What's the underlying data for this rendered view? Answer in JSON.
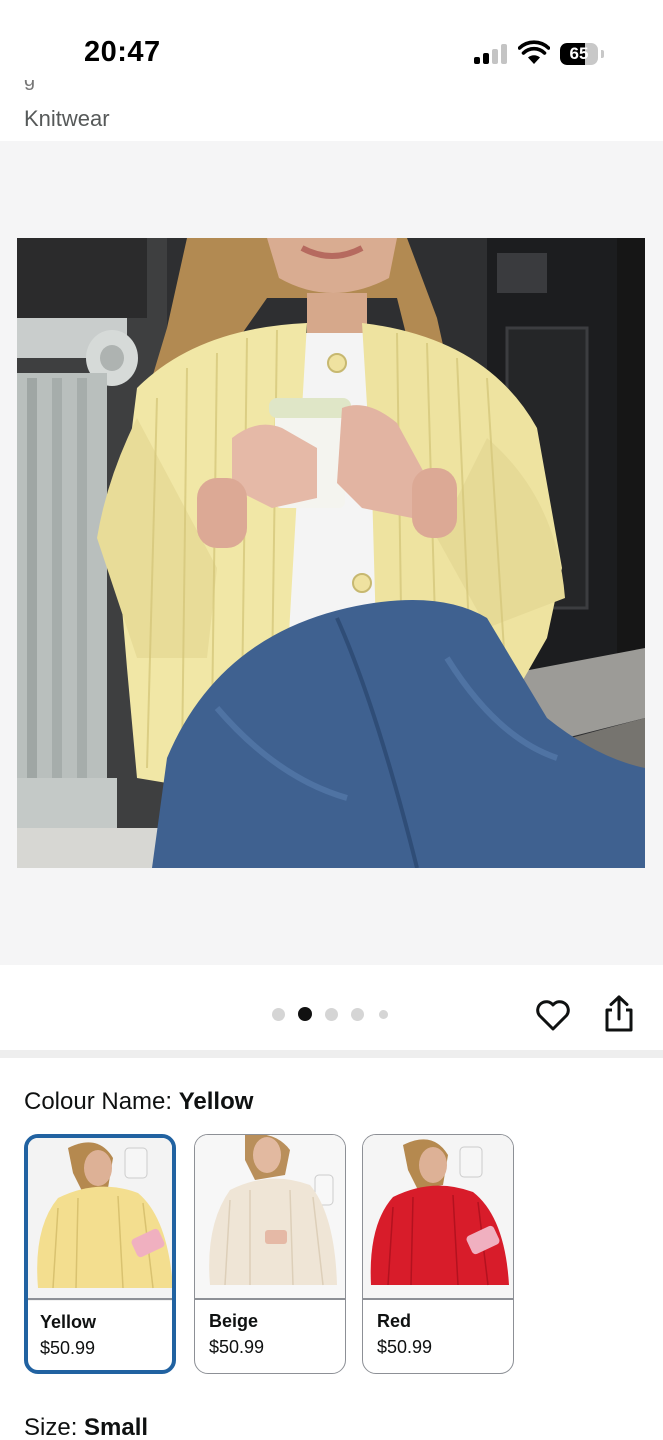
{
  "status_bar": {
    "time": "20:47",
    "battery_level": "65",
    "battery_fraction": 0.65
  },
  "breadcrumb": {
    "cut_text": "g",
    "category": "Knitwear"
  },
  "gallery": {
    "image_count": 5,
    "active_index": 1
  },
  "actions": {
    "wishlist_icon": "heart-icon",
    "share_icon": "share-icon"
  },
  "colour": {
    "label": "Colour Name: ",
    "selected": "Yellow",
    "options": [
      {
        "name": "Yellow",
        "price": "$50.99",
        "color": "#f3de8f"
      },
      {
        "name": "Beige",
        "price": "$50.99",
        "color": "#efe5d6"
      },
      {
        "name": "Red",
        "price": "$50.99",
        "color": "#d81c2a"
      }
    ]
  },
  "size": {
    "label": "Size: ",
    "selected": "Small"
  },
  "colors": {
    "accent_border": "#2162a1",
    "dot_active": "#111111",
    "dot_inactive": "#d5d5d5"
  }
}
